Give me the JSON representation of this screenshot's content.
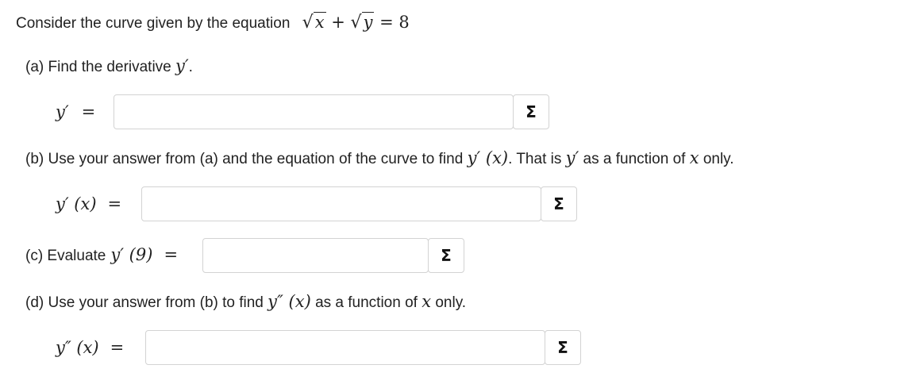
{
  "intro": {
    "text": "Consider the curve given by the equation",
    "equation": {
      "x": "x",
      "y": "y",
      "plus": "+",
      "equals": "= 8"
    }
  },
  "parts": {
    "a": {
      "prompt": "(a) Find the derivative",
      "math": "y′",
      "period": ".",
      "label": "y′",
      "equals": "="
    },
    "b": {
      "prompt_pre": "(b) Use your answer from (a) and the equation of the curve to find",
      "math1": "y′ (x)",
      "prompt_mid": ". That is",
      "math2": "y′",
      "prompt_mid2": "as a function of",
      "math3": "x",
      "prompt_post": "only.",
      "label": "y′ (x)",
      "equals": "="
    },
    "c": {
      "prompt": "(c) Evaluate",
      "math": "y′ (9)",
      "equals": "="
    },
    "d": {
      "prompt_pre": "(d) Use your answer from (b) to find",
      "math1": "y″ (x)",
      "prompt_mid": "as a function of",
      "math2": "x",
      "prompt_post": "only.",
      "label": "y″ (x)",
      "equals": "="
    }
  },
  "inputs": {
    "a": "",
    "b": "",
    "c": "",
    "d": ""
  },
  "sigma_symbol": "Σ"
}
